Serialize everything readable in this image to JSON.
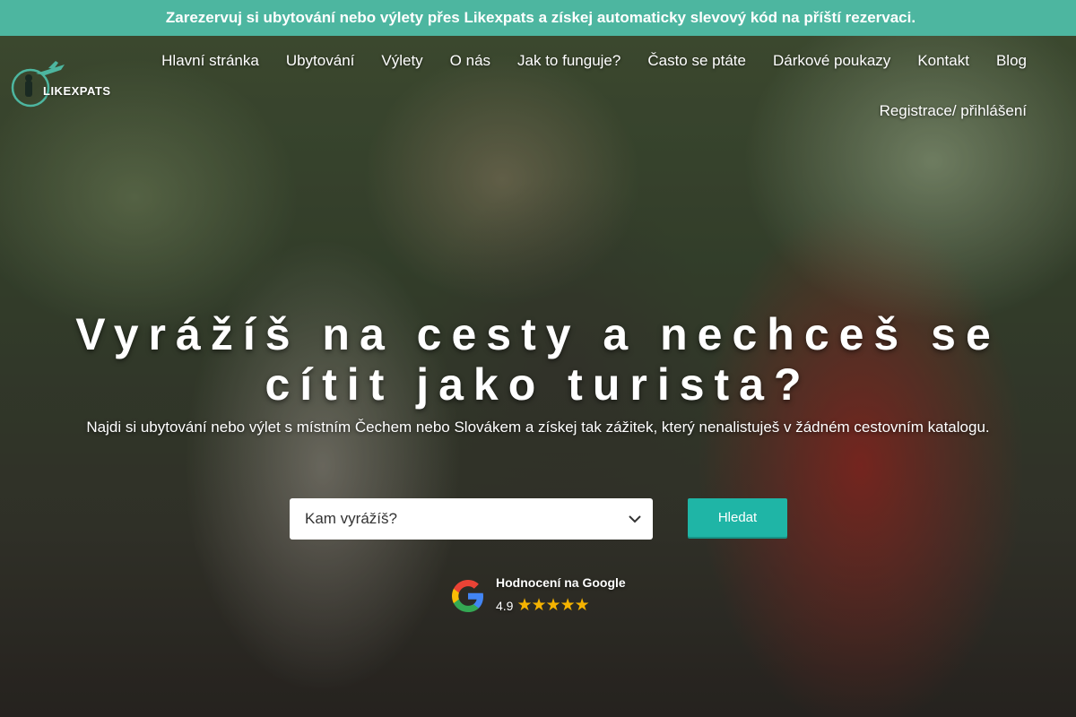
{
  "banner": {
    "icon": "",
    "text": "Zarezervuj si ubytování nebo výlety přes Likexpats a získej automaticky slevový kód na příští rezervaci."
  },
  "logo": {
    "text": "LIKEXPATS"
  },
  "nav": {
    "items": [
      {
        "label": "Hlavní stránka"
      },
      {
        "label": "Ubytování"
      },
      {
        "label": "Výlety"
      },
      {
        "label": "O nás"
      },
      {
        "label": "Jak to funguje?"
      },
      {
        "label": "Často se ptáte"
      },
      {
        "label": "Dárkové poukazy"
      },
      {
        "label": "Kontakt"
      },
      {
        "label": "Blog"
      }
    ],
    "login": "Registrace/ přihlášení"
  },
  "hero": {
    "title_line1": "Vyrážíš na cesty a nechceš se",
    "title_line2": "cítit jako turista?",
    "subtitle": "Najdi si ubytování nebo výlet s místním Čechem nebo Slovákem a získej tak zážitek, který nenalistuješ v žádném cestovním katalogu."
  },
  "search": {
    "selected": "Kam vyrážíš?",
    "button": "Hledat"
  },
  "rating": {
    "title": "Hodnocení na Google",
    "score": "4.9",
    "stars": "★★★★★"
  },
  "colors": {
    "banner": "#4db6a0",
    "button": "#1fb5a6",
    "stars": "#f5b301"
  }
}
